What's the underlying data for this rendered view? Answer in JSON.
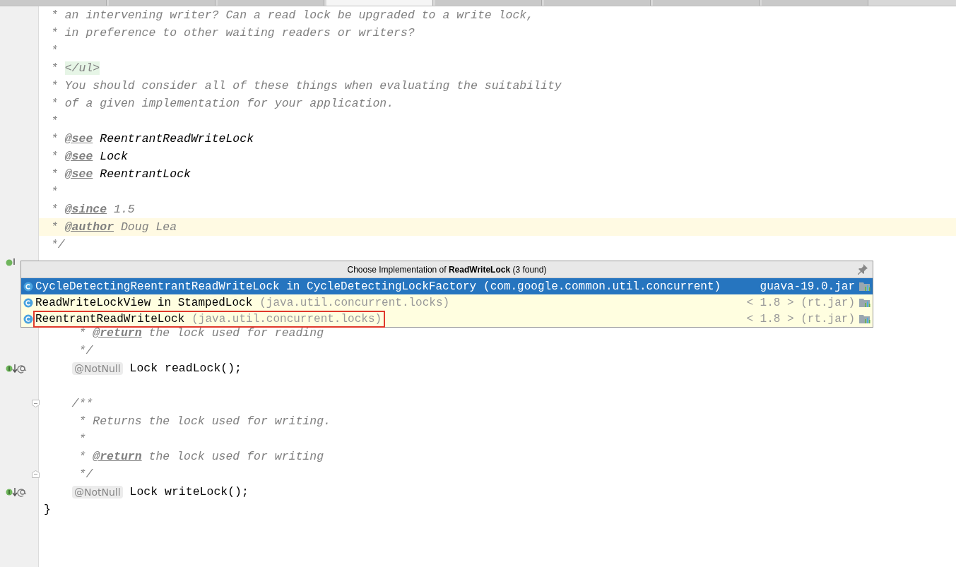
{
  "tabs": [
    {
      "selected": false
    },
    {
      "selected": false
    },
    {
      "selected": false
    },
    {
      "selected": true
    },
    {
      "selected": false
    },
    {
      "selected": false
    },
    {
      "selected": false
    },
    {
      "selected": false
    }
  ],
  "editor": {
    "lines": [
      {
        "segments": [
          {
            "kind": "comment",
            "text": " * an intervening writer? Can a read lock be upgraded to a write lock,"
          }
        ]
      },
      {
        "segments": [
          {
            "kind": "comment",
            "text": " * in preference to other waiting readers or writers?"
          }
        ]
      },
      {
        "segments": [
          {
            "kind": "comment",
            "text": " *"
          }
        ]
      },
      {
        "segments": [
          {
            "kind": "comment",
            "text": " * "
          },
          {
            "kind": "html",
            "text": "</ul>"
          }
        ]
      },
      {
        "segments": [
          {
            "kind": "comment",
            "text": " * You should consider all of these things when evaluating the suitability"
          }
        ]
      },
      {
        "segments": [
          {
            "kind": "comment",
            "text": " * of a given implementation for your application."
          }
        ]
      },
      {
        "segments": [
          {
            "kind": "comment",
            "text": " *"
          }
        ]
      },
      {
        "segments": [
          {
            "kind": "comment",
            "text": " * "
          },
          {
            "kind": "doctag",
            "text": "@see"
          },
          {
            "kind": "docref",
            "text": " ReentrantReadWriteLock"
          }
        ]
      },
      {
        "segments": [
          {
            "kind": "comment",
            "text": " * "
          },
          {
            "kind": "doctag",
            "text": "@see"
          },
          {
            "kind": "docref",
            "text": " Lock"
          }
        ]
      },
      {
        "segments": [
          {
            "kind": "comment",
            "text": " * "
          },
          {
            "kind": "doctag",
            "text": "@see"
          },
          {
            "kind": "docref",
            "text": " ReentrantLock"
          }
        ]
      },
      {
        "segments": [
          {
            "kind": "comment",
            "text": " *"
          }
        ]
      },
      {
        "segments": [
          {
            "kind": "comment",
            "text": " * "
          },
          {
            "kind": "doctag",
            "text": "@since"
          },
          {
            "kind": "comment",
            "text": " 1.5"
          }
        ]
      },
      {
        "current": true,
        "segments": [
          {
            "kind": "comment",
            "text": " * "
          },
          {
            "kind": "doctag",
            "text": "@author"
          },
          {
            "kind": "comment",
            "text": " Doug Lea"
          }
        ]
      },
      {
        "segments": [
          {
            "kind": "comment",
            "text": " */"
          }
        ]
      },
      {
        "interface_marker": true
      },
      {
        "blank": true
      },
      {
        "blank": true
      },
      {
        "blank": true
      },
      {
        "segments": [
          {
            "kind": "comment",
            "text": "     * "
          },
          {
            "kind": "doctag",
            "text": "@return"
          },
          {
            "kind": "comment",
            "text": " the lock used for reading"
          }
        ]
      },
      {
        "segments": [
          {
            "kind": "comment",
            "text": "     */"
          }
        ]
      },
      {
        "implementation_marker": true,
        "segments": [
          {
            "kind": "hint",
            "text": "@NotNull"
          },
          {
            "kind": "plain",
            "text": " Lock readLock();"
          }
        ]
      },
      {
        "blank": true
      },
      {
        "fold_start": true,
        "segments": [
          {
            "kind": "comment",
            "text": "    /**"
          }
        ]
      },
      {
        "segments": [
          {
            "kind": "comment",
            "text": "     * Returns the lock used for writing."
          }
        ]
      },
      {
        "segments": [
          {
            "kind": "comment",
            "text": "     *"
          }
        ]
      },
      {
        "segments": [
          {
            "kind": "comment",
            "text": "     * "
          },
          {
            "kind": "doctag",
            "text": "@return"
          },
          {
            "kind": "comment",
            "text": " the lock used for writing"
          }
        ]
      },
      {
        "fold_end": true,
        "segments": [
          {
            "kind": "comment",
            "text": "     */"
          }
        ]
      },
      {
        "implementation_marker": true,
        "segments": [
          {
            "kind": "hint",
            "text": "@NotNull"
          },
          {
            "kind": "plain",
            "text": " Lock writeLock();"
          }
        ]
      },
      {
        "segments": [
          {
            "kind": "plain",
            "text": "}"
          }
        ]
      }
    ]
  },
  "popup": {
    "title": "Choose Implementation of **ReadWriteLock** (3 found)",
    "items": [
      {
        "name": "CycleDetectingReentrantReadWriteLock in CycleDetectingLockFactory",
        "package": "(com.google.common.util.concurrent)",
        "library": "guava-19.0.jar",
        "selected": true,
        "outlined": false
      },
      {
        "name": "ReadWriteLockView in StampedLock",
        "package": "(java.util.concurrent.locks)",
        "library": "< 1.8 > (rt.jar)",
        "selected": false,
        "outlined": false
      },
      {
        "name": "ReentrantReadWriteLock",
        "package": "(java.util.concurrent.locks)",
        "library": "< 1.8 > (rt.jar)",
        "selected": false,
        "outlined": true
      }
    ]
  }
}
